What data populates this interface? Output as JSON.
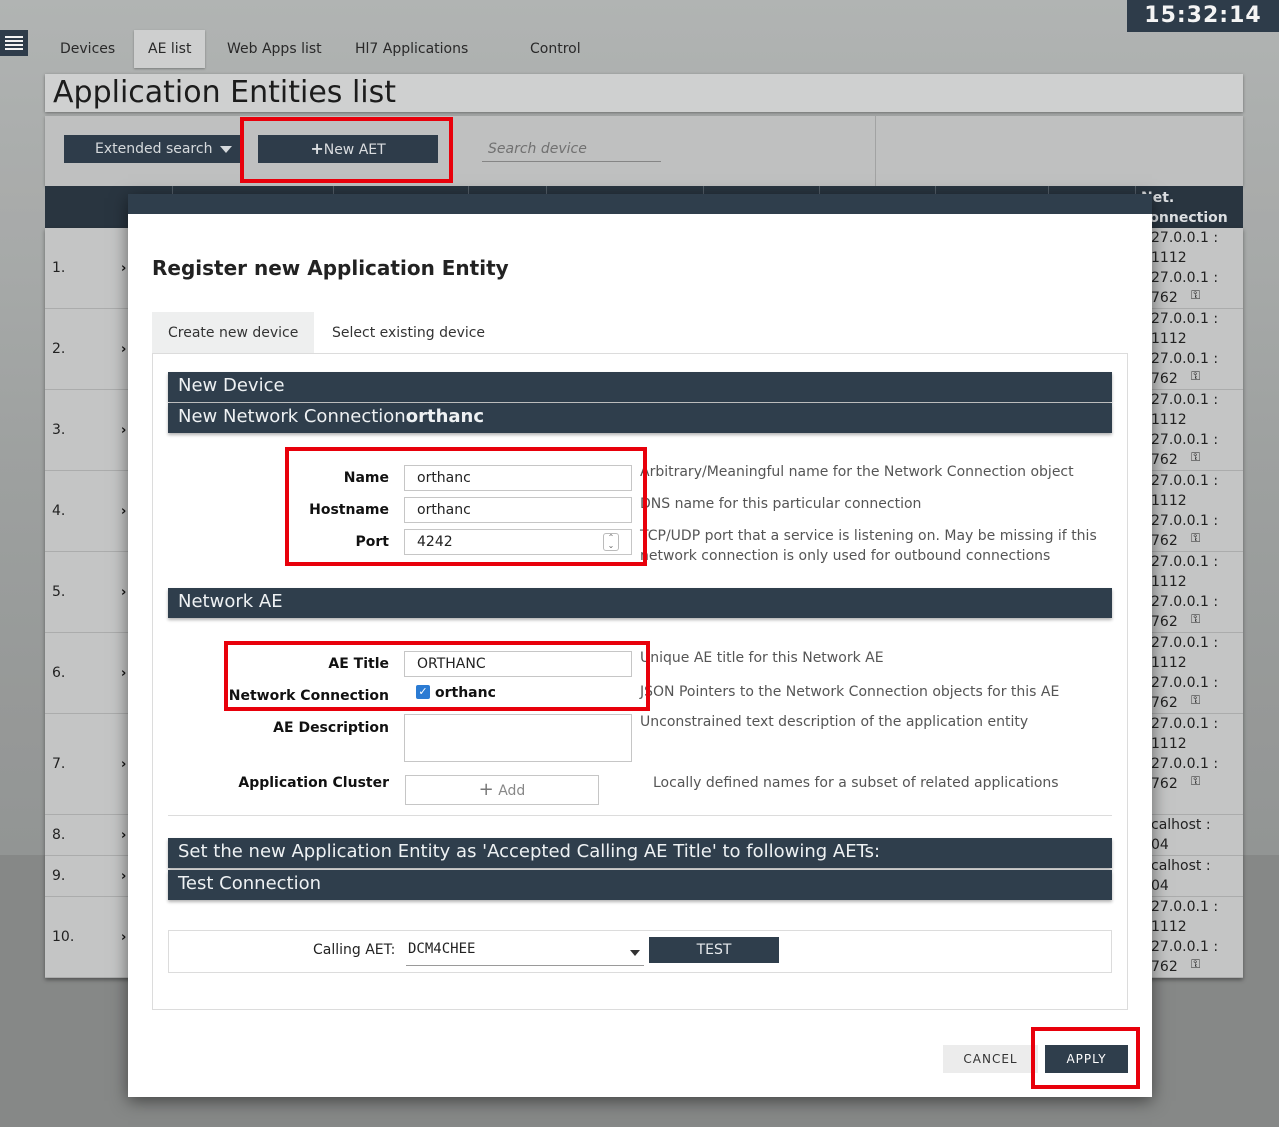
{
  "clock": "15:32:14",
  "nav": {
    "menu_icon": "hamburger-icon",
    "tabs": [
      {
        "label": "Devices"
      },
      {
        "label": "AE list"
      },
      {
        "label": "Web Apps list"
      },
      {
        "label": "Hl7 Applications"
      },
      {
        "label": "Control"
      }
    ],
    "active_tab": "AE list"
  },
  "page": {
    "title": "Application Entities list"
  },
  "toolbar": {
    "extended_search": "Extended search",
    "new_aet": "New AET",
    "search_placeholder": "Search device"
  },
  "table": {
    "visible_header": "Net.\nconnection",
    "rows": [
      {
        "num": "1.",
        "conn": "27.0.0.1 :\n1112\n27.0.0.1 :\n762"
      },
      {
        "num": "2.",
        "conn": "27.0.0.1 :\n1112\n27.0.0.1 :\n762"
      },
      {
        "num": "3.",
        "conn": "27.0.0.1 :\n1112\n27.0.0.1 :\n762"
      },
      {
        "num": "4.",
        "conn": "27.0.0.1 :\n1112\n27.0.0.1 :\n762"
      },
      {
        "num": "5.",
        "conn": "27.0.0.1 :\n1112\n27.0.0.1 :\n762"
      },
      {
        "num": "6.",
        "conn": "27.0.0.1 :\n1112\n27.0.0.1 :\n762"
      },
      {
        "num": "7.",
        "conn": "27.0.0.1 :\n1112\n27.0.0.1 :\n762"
      },
      {
        "num": "8.",
        "conn": "calhost :\n04"
      },
      {
        "num": "9.",
        "conn": "calhost :\n04"
      },
      {
        "num": "10.",
        "conn": "27.0.0.1 :\n1112\n27.0.0.1 :\n762"
      }
    ]
  },
  "dialog": {
    "title": "Register new Application Entity",
    "tabs": [
      {
        "label": "Create new device"
      },
      {
        "label": "Select existing device"
      }
    ],
    "sections": {
      "new_device": "New Device",
      "new_network_connection": "New Network Connection",
      "new_network_connection_name": "orthanc",
      "network_ae": "Network AE",
      "accepted_calling": "Set the new Application Entity as 'Accepted Calling AE Title' to following AETs:",
      "test_connection": "Test Connection"
    },
    "connection": {
      "name_label": "Name",
      "name_value": "orthanc",
      "name_desc": "Arbitrary/Meaningful name for the Network Connection object",
      "hostname_label": "Hostname",
      "hostname_value": "orthanc",
      "hostname_desc": "DNS name for this particular connection",
      "port_label": "Port",
      "port_value": "4242",
      "port_desc_1": "TCP/UDP port that a service is listening on. May be missing if this",
      "port_desc_2": "network connection is only used for outbound connections"
    },
    "ae": {
      "ae_title_label": "AE Title",
      "ae_title_value": "ORTHANC",
      "ae_title_desc": "Unique AE title for this Network AE",
      "network_connection_label": "Network Connection",
      "network_connection_value": "orthanc",
      "network_connection_checked": true,
      "network_connection_desc": "JSON Pointers to the Network Connection objects for this AE",
      "ae_description_label": "AE Description",
      "ae_description_desc": "Unconstrained text description of the application entity",
      "app_cluster_label": "Application Cluster",
      "app_cluster_add": "Add",
      "app_cluster_desc": "Locally defined names for a subset of related applications"
    },
    "test": {
      "calling_aet_label": "Calling AET:",
      "calling_aet_value": "DCM4CHEE",
      "test_button": "TEST"
    },
    "buttons": {
      "cancel": "CANCEL",
      "apply": "APPLY"
    }
  },
  "colors": {
    "primary": "#2f3e4c",
    "highlight": "#e8000b",
    "checkbox": "#2b7bd3"
  }
}
